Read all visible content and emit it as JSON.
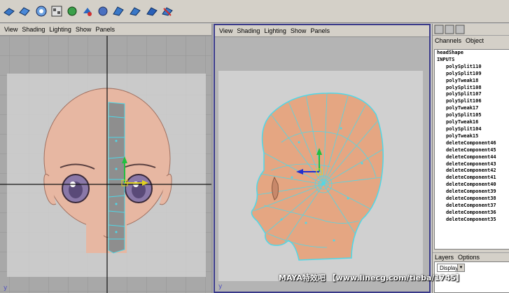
{
  "toolbar": {
    "icons": [
      "poly-cube-icon",
      "poly-sphere-icon",
      "select-icon",
      "lasso-icon",
      "snap-icon",
      "magnet-icon",
      "paint-icon",
      "camera-icon",
      "sculpt-icon",
      "ramp-icon",
      "bevel-icon",
      "extrude-icon",
      "split-icon",
      "cut-icon"
    ]
  },
  "left_panel": {
    "menu": [
      "View",
      "Shading",
      "Lighting",
      "Show",
      "Panels"
    ],
    "axis": "y"
  },
  "right_panel": {
    "menu": [
      "View",
      "Shading",
      "Lighting",
      "Show",
      "Panels"
    ],
    "axis": "y"
  },
  "channel_box": {
    "tabs": [
      "Channels",
      "Object"
    ],
    "shape": "headShape",
    "inputs_label": "INPUTS",
    "inputs": [
      "polySplit110",
      "polySplit109",
      "polyTweak18",
      "polySplit108",
      "polySplit107",
      "polySplit106",
      "polyTweak17",
      "polySplit105",
      "polyTweak16",
      "polySplit104",
      "polyTweak15",
      "deleteComponent46",
      "deleteComponent45",
      "deleteComponent44",
      "deleteComponent43",
      "deleteComponent42",
      "deleteComponent41",
      "deleteComponent40",
      "deleteComponent39",
      "deleteComponent38",
      "deleteComponent37",
      "deleteComponent36",
      "deleteComponent35"
    ]
  },
  "layers": {
    "tabs": [
      "Layers",
      "Options"
    ],
    "display_select": "Display"
  },
  "watermark": "MAYA特效吧 【www.linecg.com/tieba/1745】",
  "colors": {
    "skin": "#e8b08a",
    "wire": "#4fd8e8",
    "grid_bg": "#a8a8a8",
    "panel_bg": "#d4d0c8"
  }
}
